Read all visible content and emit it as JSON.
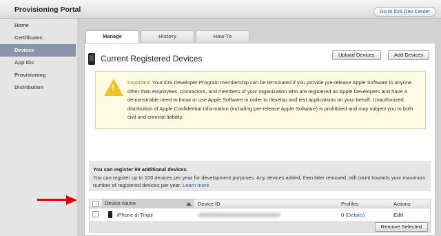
{
  "header": {
    "title": "Provisioning Portal",
    "dev_center_button": "Go to iOS Dev Center"
  },
  "sidebar": {
    "items": [
      {
        "label": "Home"
      },
      {
        "label": "Certificates"
      },
      {
        "label": "Devices",
        "active": true
      },
      {
        "label": "App IDs"
      },
      {
        "label": "Provisioning"
      },
      {
        "label": "Distribution"
      }
    ]
  },
  "tabs": [
    {
      "label": "Manage",
      "active": true
    },
    {
      "label": "History"
    },
    {
      "label": "How To"
    }
  ],
  "panel": {
    "title": "Current Registered Devices",
    "upload_button": "Upload Devices",
    "add_button": "Add Devices"
  },
  "warning": {
    "lead": "Important:",
    "text": " Your iOS Developer Program membership can be terminated if you provide pre-release Apple Software to anyone other than employees, contractors, and members of your organization who are registered as Apple Developers and have a demonstrable need to know or use Apple Software in order to develop and test applications on your behalf. Unauthorized distribution of Apple Confidential Information (including pre-release Apple Software) is prohibited and may subject you to both civil and criminal liability."
  },
  "info": {
    "heading": "You can register 99 additional devices.",
    "body": "You can register up to 100 devices per year for development purposes. Any devices added, then later removed, still count towards your maximum number of registered devices per year.",
    "link": "Learn more"
  },
  "table": {
    "headers": {
      "name": "Device Name",
      "id": "Device ID",
      "profiles": "Profiles",
      "actions": "Actions"
    },
    "rows": [
      {
        "name": "iPhone di Triqui",
        "profiles_count": "0",
        "profiles_link": "(Details)",
        "action": "Edit"
      }
    ],
    "remove_button": "Remove Selected"
  },
  "colors": {
    "accent": "#8794a9",
    "link": "#2e5ea6",
    "warning": "#efc427",
    "arrow": "#e00000"
  }
}
